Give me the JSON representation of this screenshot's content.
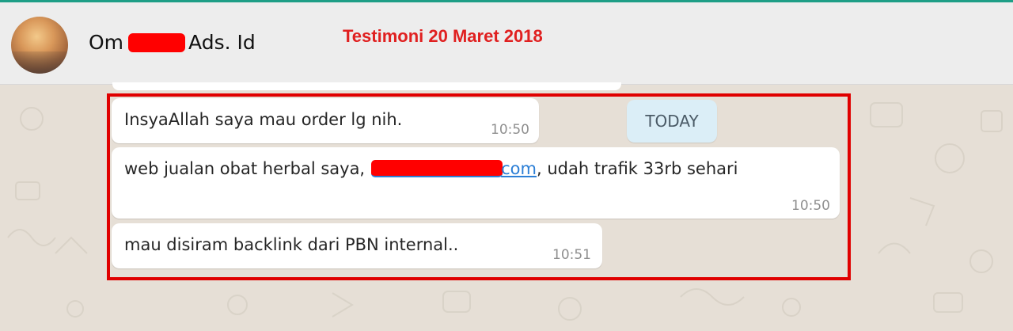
{
  "header": {
    "name_prefix": "Om",
    "name_suffix": "Ads. Id",
    "annotation": "Testimoni 20 Maret 2018"
  },
  "date_chip": "TODAY",
  "messages": [
    {
      "text": "InsyaAllah saya mau order lg nih.",
      "time": "10:50"
    },
    {
      "text_before": "web jualan obat herbal saya,",
      "link_tail": "com",
      "text_after": ", udah trafik 33rb sehari",
      "time": "10:50"
    },
    {
      "text": "mau disiram backlink dari PBN internal..",
      "time": "10:51"
    }
  ],
  "colors": {
    "header_bg": "#ededed",
    "accent": "#1e9e86",
    "highlight": "#e00000",
    "link": "#2c7fd6",
    "chip_bg": "#dbeef7"
  }
}
